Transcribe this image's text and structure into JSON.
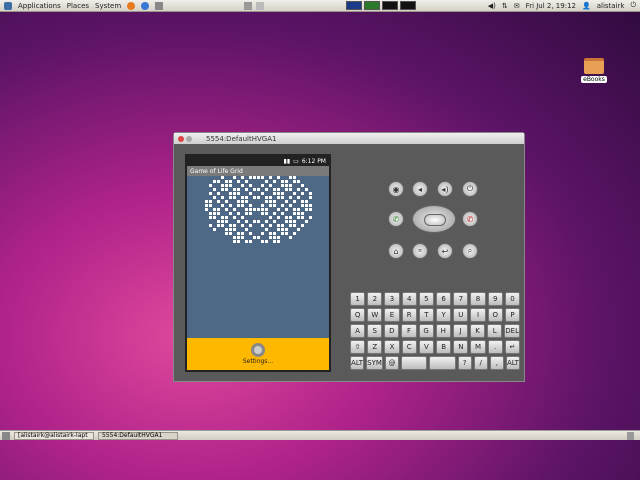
{
  "top_panel": {
    "applications": "Applications",
    "places": "Places",
    "system": "System",
    "clock": "Fri Jul 2, 19:12",
    "user": "alistairk"
  },
  "bottom_panel": {
    "task1": "[alistairk@alistairk-lapt",
    "task2": "5554:DefaultHVGA1"
  },
  "desktop": {
    "ebooks_label": "eBooks"
  },
  "emulator": {
    "title": "5554:DefaultHVGA1",
    "time": "6:12 PM",
    "app_title": "Game of Life Grid",
    "menu_label": "Settings..."
  },
  "keyboard": {
    "row1": [
      "1",
      "2",
      "3",
      "4",
      "5",
      "6",
      "7",
      "8",
      "9",
      "0"
    ],
    "row2": [
      "Q",
      "W",
      "E",
      "R",
      "T",
      "Y",
      "U",
      "I",
      "O",
      "P"
    ],
    "row3": [
      "A",
      "S",
      "D",
      "F",
      "G",
      "H",
      "J",
      "K",
      "L",
      "DEL"
    ],
    "row4": [
      "⇧",
      "Z",
      "X",
      "C",
      "V",
      "B",
      "N",
      "M",
      ".",
      "↵"
    ],
    "row5": [
      "ALT",
      "SYM",
      "@",
      "",
      "",
      "?",
      "/",
      ",",
      "ALT"
    ]
  },
  "colors": {
    "grid_bg": "#4d6985",
    "cell": "#ffffff",
    "menu_bg": "#ffb800"
  }
}
